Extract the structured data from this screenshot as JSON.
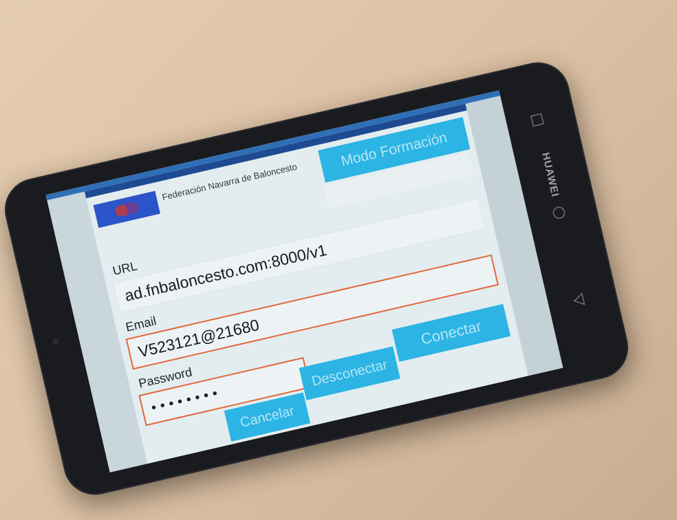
{
  "organization": {
    "name": "Federación Navarra de Baloncesto"
  },
  "buttons": {
    "mode_training": "Modo Formación",
    "connect": "Conectar",
    "disconnect": "Desconectar",
    "cancel": "Cancelar"
  },
  "form": {
    "url_label": "URL",
    "url_value": "ad.fnbaloncesto.com:8000/v1",
    "email_label": "Email",
    "email_value": "V523121@21680",
    "password_label": "Password",
    "password_value": "••••••••"
  },
  "device": {
    "brand": "HUAWEI",
    "nav_icons": [
      "square-recent-icon",
      "circle-home-icon",
      "triangle-back-icon"
    ]
  },
  "colors": {
    "button_blue": "#2bb4e4",
    "button_text": "#b5e7f7",
    "header_blue": "#1e4a92",
    "focus_orange": "#e2683b"
  }
}
